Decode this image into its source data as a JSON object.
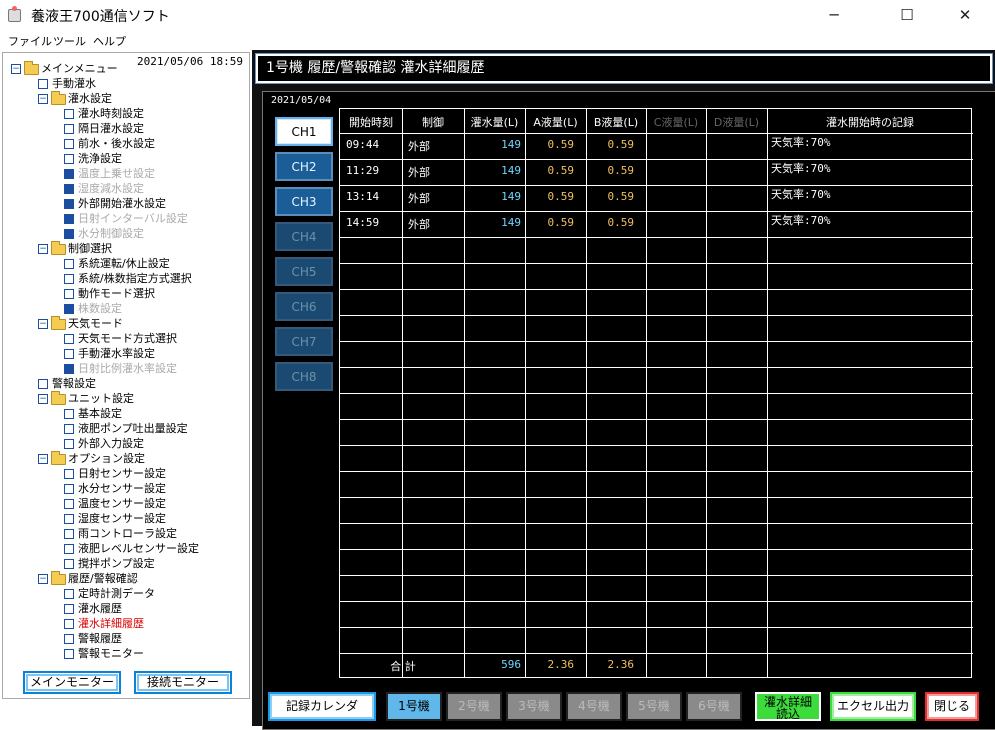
{
  "window": {
    "title": "養液王700通信ソフト",
    "min": "─",
    "max": "☐",
    "close": "✕"
  },
  "menu": [
    "ファイル",
    "ツール",
    "ヘルプ"
  ],
  "sidebar": {
    "datetime": "2021/05/06  18:59",
    "tree": [
      {
        "l": "メインメニュー",
        "d": 0,
        "t": "folder"
      },
      {
        "l": "手動灌水",
        "d": 1,
        "t": "leaf"
      },
      {
        "l": "灌水設定",
        "d": 1,
        "t": "folder"
      },
      {
        "l": "灌水時刻設定",
        "d": 2,
        "t": "leaf"
      },
      {
        "l": "隔日灌水設定",
        "d": 2,
        "t": "leaf"
      },
      {
        "l": "前水・後水設定",
        "d": 2,
        "t": "leaf"
      },
      {
        "l": "洗浄設定",
        "d": 2,
        "t": "leaf"
      },
      {
        "l": "温度上乗せ設定",
        "d": 2,
        "t": "leaf",
        "s": "dis",
        "f": 1
      },
      {
        "l": "湿度減水設定",
        "d": 2,
        "t": "leaf",
        "s": "dis",
        "f": 1
      },
      {
        "l": "外部開始灌水設定",
        "d": 2,
        "t": "leaf",
        "f": 1
      },
      {
        "l": "日射インターバル設定",
        "d": 2,
        "t": "leaf",
        "s": "dis",
        "f": 1
      },
      {
        "l": "水分制御設定",
        "d": 2,
        "t": "leaf",
        "s": "dis",
        "f": 1
      },
      {
        "l": "制御選択",
        "d": 1,
        "t": "folder"
      },
      {
        "l": "系統運転/休止設定",
        "d": 2,
        "t": "leaf"
      },
      {
        "l": "系統/株数指定方式選択",
        "d": 2,
        "t": "leaf"
      },
      {
        "l": "動作モード選択",
        "d": 2,
        "t": "leaf"
      },
      {
        "l": "株数設定",
        "d": 2,
        "t": "leaf",
        "s": "dis",
        "f": 1
      },
      {
        "l": "天気モード",
        "d": 1,
        "t": "folder"
      },
      {
        "l": "天気モード方式選択",
        "d": 2,
        "t": "leaf"
      },
      {
        "l": "手動灌水率設定",
        "d": 2,
        "t": "leaf"
      },
      {
        "l": "日射比例灌水率設定",
        "d": 2,
        "t": "leaf",
        "s": "dis",
        "f": 1
      },
      {
        "l": "警報設定",
        "d": 1,
        "t": "leaf"
      },
      {
        "l": "ユニット設定",
        "d": 1,
        "t": "folder"
      },
      {
        "l": "基本設定",
        "d": 2,
        "t": "leaf"
      },
      {
        "l": "液肥ポンプ吐出量設定",
        "d": 2,
        "t": "leaf"
      },
      {
        "l": "外部入力設定",
        "d": 2,
        "t": "leaf"
      },
      {
        "l": "オプション設定",
        "d": 1,
        "t": "folder"
      },
      {
        "l": "日射センサー設定",
        "d": 2,
        "t": "leaf"
      },
      {
        "l": "水分センサー設定",
        "d": 2,
        "t": "leaf"
      },
      {
        "l": "温度センサー設定",
        "d": 2,
        "t": "leaf"
      },
      {
        "l": "湿度センサー設定",
        "d": 2,
        "t": "leaf"
      },
      {
        "l": "雨コントローラ設定",
        "d": 2,
        "t": "leaf"
      },
      {
        "l": "液肥レベルセンサー設定",
        "d": 2,
        "t": "leaf"
      },
      {
        "l": "撹拌ポンプ設定",
        "d": 2,
        "t": "leaf"
      },
      {
        "l": "履歴/警報確認",
        "d": 1,
        "t": "folder"
      },
      {
        "l": "定時計測データ",
        "d": 2,
        "t": "leaf"
      },
      {
        "l": "灌水履歴",
        "d": 2,
        "t": "leaf"
      },
      {
        "l": "灌水詳細履歴",
        "d": 2,
        "t": "leaf",
        "s": "sel"
      },
      {
        "l": "警報履歴",
        "d": 2,
        "t": "leaf"
      },
      {
        "l": "警報モニター",
        "d": 2,
        "t": "leaf"
      }
    ],
    "main_monitor": "メインモニター",
    "conn_monitor": "接続モニター"
  },
  "header": {
    "title": "1号機  履歴/警報確認   灌水詳細履歴"
  },
  "panel": {
    "date": "2021/05/04"
  },
  "channels": [
    {
      "l": "CH1",
      "s": "active"
    },
    {
      "l": "CH2",
      "s": "on"
    },
    {
      "l": "CH3",
      "s": "on"
    },
    {
      "l": "CH4",
      "s": "off"
    },
    {
      "l": "CH5",
      "s": "off"
    },
    {
      "l": "CH6",
      "s": "off"
    },
    {
      "l": "CH7",
      "s": "off"
    },
    {
      "l": "CH8",
      "s": "off"
    }
  ],
  "table": {
    "headers": [
      "開始時刻",
      "制御",
      "灌水量(L)",
      "A液量(L)",
      "B液量(L)",
      "C液量(L)",
      "D液量(L)",
      "灌水開始時の記録"
    ],
    "rows": [
      [
        "09:44",
        "外部",
        "149",
        "0.59",
        "0.59",
        "",
        "",
        "天気率:70%"
      ],
      [
        "11:29",
        "外部",
        "149",
        "0.59",
        "0.59",
        "",
        "",
        "天気率:70%"
      ],
      [
        "13:14",
        "外部",
        "149",
        "0.59",
        "0.59",
        "",
        "",
        "天気率:70%"
      ],
      [
        "14:59",
        "外部",
        "149",
        "0.59",
        "0.59",
        "",
        "",
        "天気率:70%"
      ]
    ],
    "total_label": "合  計",
    "totals": [
      "596",
      "2.36",
      "2.36"
    ]
  },
  "footer": {
    "calendar": "記録カレンダ",
    "units": [
      "1号機",
      "2号機",
      "3号機",
      "4号機",
      "5号機",
      "6号機"
    ],
    "detail_line1": "灌水詳細",
    "detail_line2": "読込",
    "excel": "エクセル出力",
    "close": "閉じる"
  },
  "colors": {
    "water": "#6fd6ff",
    "liquid": "#f0c060",
    "active_red": "#d00"
  }
}
